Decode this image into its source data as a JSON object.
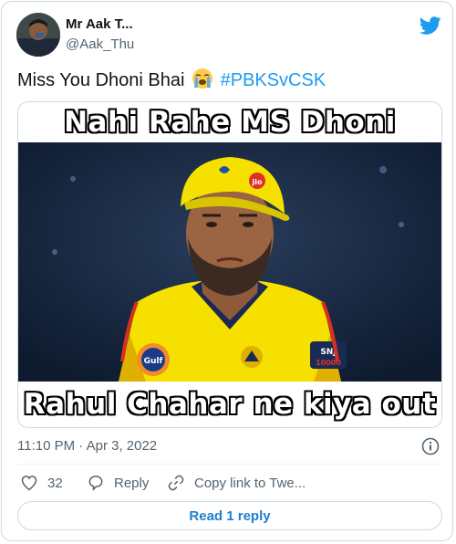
{
  "author": {
    "display_name": "Mr Aak T...",
    "handle": "@Aak_Thu"
  },
  "tweet": {
    "text_before": "Miss You Dhoni Bhai",
    "emoji": "loudly-crying-face",
    "hashtag": "#PBKSvCSK"
  },
  "media": {
    "top_caption": "Nahi Rahe MS Dhoni",
    "bottom_caption": "Rahul Chahar ne kiya out",
    "jersey_sponsors": [
      "Gulf",
      "SNJ 10000"
    ]
  },
  "meta": {
    "timestamp": "11:10 PM · Apr 3, 2022"
  },
  "actions": {
    "like_count": "32",
    "reply_label": "Reply",
    "copy_label": "Copy link to Twe..."
  },
  "replies_button": "Read 1 reply",
  "colors": {
    "accent": "#1d9bf0",
    "secondary_text": "#536471",
    "border": "#cfd9de",
    "jersey_yellow": "#f5e000"
  },
  "icons": [
    "twitter-bird-icon",
    "info-icon",
    "heart-icon",
    "reply-icon",
    "link-icon"
  ]
}
